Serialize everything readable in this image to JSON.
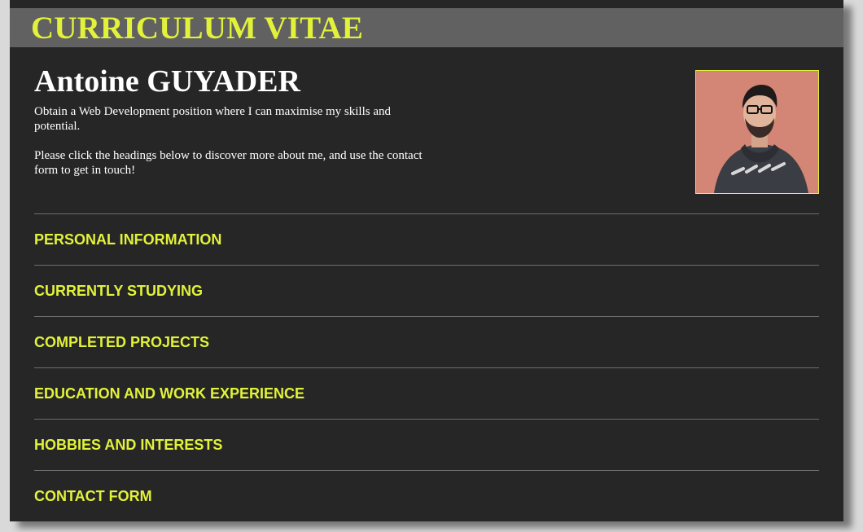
{
  "banner": {
    "title": "CURRICULUM VITAE"
  },
  "profile": {
    "name": "Antoine GUYADER",
    "objective": "Obtain a Web Development position where I can maximise my skills and potential.",
    "instructions": "Please click the headings below to discover more about me, and use the contact form to get in touch!",
    "photo_alt": "Antoine GUYADER portrait"
  },
  "colors": {
    "accent": "#e2f23a",
    "panel": "#262626",
    "banner": "#616161",
    "divider": "#6d6d6d"
  },
  "sections": [
    {
      "label": "PERSONAL INFORMATION"
    },
    {
      "label": "CURRENTLY STUDYING"
    },
    {
      "label": "COMPLETED PROJECTS"
    },
    {
      "label": "EDUCATION AND WORK EXPERIENCE"
    },
    {
      "label": "HOBBIES AND INTERESTS"
    },
    {
      "label": "CONTACT FORM"
    }
  ]
}
